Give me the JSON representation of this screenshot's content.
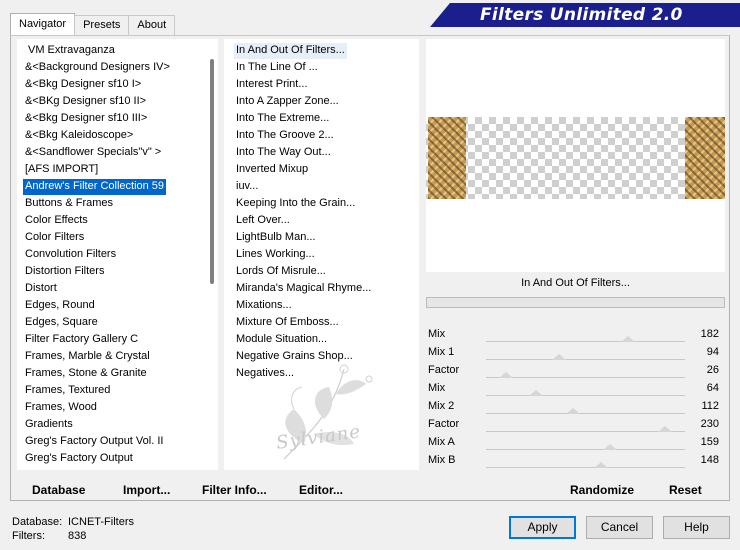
{
  "tabs": [
    {
      "label": "Navigator",
      "active": true
    },
    {
      "label": "Presets",
      "active": false
    },
    {
      "label": "About",
      "active": false
    }
  ],
  "banner": "Filters Unlimited 2.0",
  "categories": [
    "VM Extravaganza",
    "&<Background Designers IV>",
    "&<Bkg Designer sf10 I>",
    "&<BKg Designer sf10 II>",
    "&<Bkg Designer sf10 III>",
    "&<Bkg Kaleidoscope>",
    "&<Sandflower Specials\"v\" >",
    "[AFS IMPORT]",
    "Andrew's Filter Collection 59",
    "Buttons & Frames",
    "Color Effects",
    "Color Filters",
    "Convolution Filters",
    "Distortion Filters",
    "Distort",
    "Edges, Round",
    "Edges, Square",
    "Filter Factory Gallery C",
    "Frames, Marble & Crystal",
    "Frames, Stone & Granite",
    "Frames, Textured",
    "Frames, Wood",
    "Gradients",
    "Greg's Factory Output Vol. II",
    "Greg's Factory Output"
  ],
  "selected_category": 8,
  "filters": [
    "In And Out Of Filters...",
    "In The Line Of ...",
    "Interest Print...",
    "Into A Zapper Zone...",
    "Into The Extreme...",
    "Into The Groove 2...",
    "Into The Way Out...",
    "Inverted Mixup",
    "iuv...",
    "Keeping Into the Grain...",
    "Left Over...",
    "LightBulb Man...",
    "Lines Working...",
    "Lords Of Misrule...",
    "Miranda's Magical Rhyme...",
    "Mixations...",
    "Mixture Of Emboss...",
    "Module Situation...",
    "Negative Grains Shop...",
    "Negatives..."
  ],
  "selected_filter": 0,
  "current_filter": "In And Out Of Filters...",
  "sliders": [
    {
      "label": "Mix",
      "value": "182"
    },
    {
      "label": "Mix 1",
      "value": "94"
    },
    {
      "label": "Factor",
      "value": "26"
    },
    {
      "label": "Mix",
      "value": "64"
    },
    {
      "label": "Mix 2",
      "value": "112"
    },
    {
      "label": "Factor",
      "value": "230"
    },
    {
      "label": "Mix A",
      "value": "159"
    },
    {
      "label": "Mix B",
      "value": "148"
    }
  ],
  "bottom_links": {
    "database": "Database",
    "import": "Import...",
    "filter_info": "Filter Info...",
    "editor": "Editor...",
    "randomize": "Randomize",
    "reset": "Reset"
  },
  "footer": {
    "database_label": "Database:",
    "database_value": "ICNET-Filters",
    "filters_label": "Filters:",
    "filters_value": "838"
  },
  "buttons": {
    "apply": "Apply",
    "cancel": "Cancel",
    "help": "Help"
  },
  "watermark": "Sylviane"
}
